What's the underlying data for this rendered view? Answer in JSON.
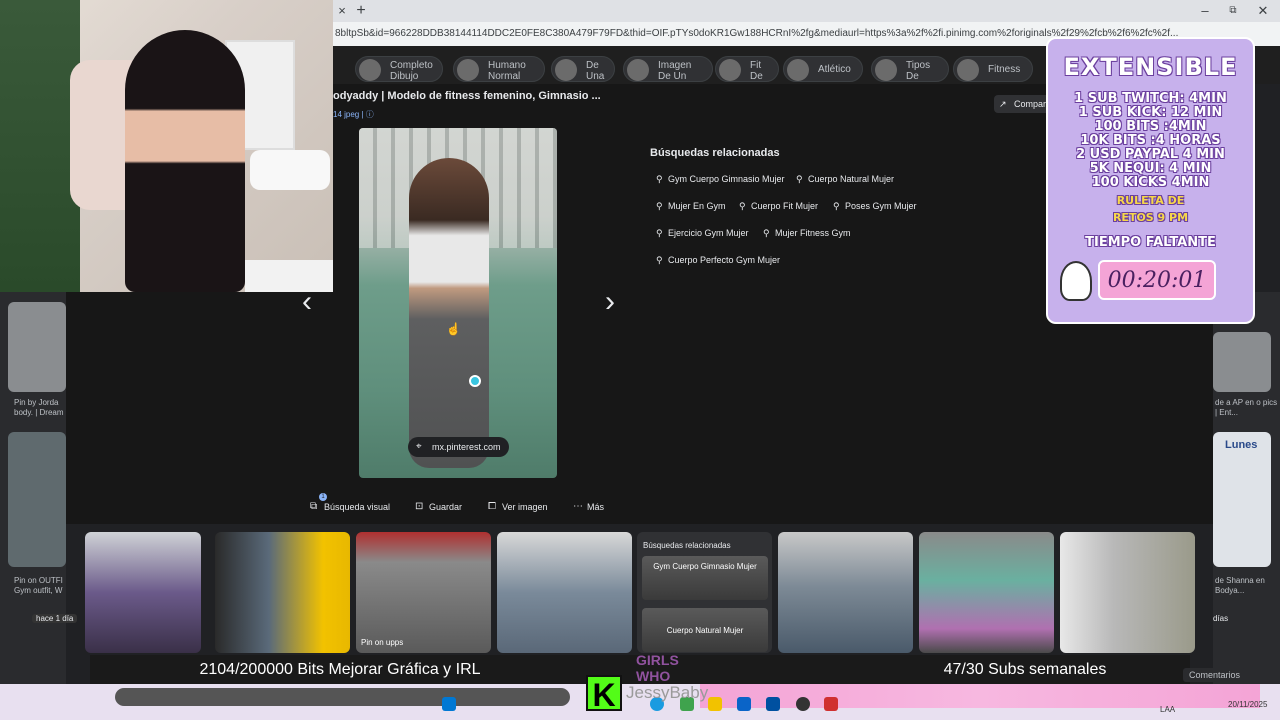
{
  "browser": {
    "new_tab": "+",
    "close_tab": "×",
    "url": "8bltpSb&id=966228DDB38144114DDC2E0FE8C380A479F79FD&thid=OIF.pTYs0doKR1Gw188HCRnI%2fg&mediaurl=https%3a%2f%2fi.pinimg.com%2foriginals%2f29%2fcb%2f6%2fc%2f...",
    "minimize": "–",
    "restore": "⧉",
    "close": "✕"
  },
  "chips": [
    {
      "label": "Completo Dibujo"
    },
    {
      "label": "Humano Normal"
    },
    {
      "label": "De Una"
    },
    {
      "label": "Imagen De Un"
    },
    {
      "label": "Fit De"
    },
    {
      "label": "Atlético"
    },
    {
      "label": "Tipos De"
    },
    {
      "label": "Fitness"
    }
  ],
  "viewer": {
    "title": "odyaddy | Modelo de fitness femenino, Gimnasio ...",
    "meta": "14 jpeg  |  ⓘ",
    "source": "mx.pinterest.com",
    "share": "Compart"
  },
  "related": {
    "heading": "Búsquedas relacionadas",
    "items": [
      "Gym Cuerpo Gimnasio Mujer",
      "Cuerpo Natural Mujer",
      "Mujer En Gym",
      "Cuerpo Fit Mujer",
      "Poses Gym Mujer",
      "Ejercicio Gym Mujer",
      "Mujer Fitness Gym",
      "Cuerpo Perfecto Gym Mujer"
    ]
  },
  "actions": {
    "visual_search": "Búsqueda visual",
    "badge": "1",
    "save": "Guardar",
    "view_image": "Ver imagen",
    "more": "Más"
  },
  "grid": {
    "card_title": "Búsquedas relacionadas",
    "card_item_1": "Gym Cuerpo Gimnasio Mujer",
    "card_item_2": "Cuerpo Natural Mujer",
    "pin_label": "Pin on upps"
  },
  "left_strip": {
    "caption_1": "Pin by Jorda body. | Dream",
    "caption_2": "Pin on OUTFI Gym outfit, W",
    "hace": "hace 1 día"
  },
  "right_strip": {
    "caption_1": "de a AP en o pics | Ent...",
    "caption_2": "de Shanna en Bodya...",
    "dias": "días",
    "lunes": "Lunes"
  },
  "widget": {
    "title": "EXTENSIBLE",
    "lines": [
      "1 SUB TWITCH: 4MIN",
      "1 SUB KICK: 12 MIN",
      "100 BITS :4MIN",
      "10K BITS :4 HORAS",
      "2 USD PAYPAL 4 MIN",
      "5K NEQUI: 4 MIN",
      "100 KICKS 4MIN"
    ],
    "ruleta_1": "RULETA DE",
    "ruleta_2": "RETOS 9 PM",
    "tiempo": "TIEMPO FALTANTE",
    "timer": "00:20:01"
  },
  "overlay": {
    "goal_bits": "2104/200000 Bits Mejorar Gráfica y IRL",
    "goal_subs": "47/30 Subs semanales",
    "girls_who": "GIRLS WHO",
    "kick_logo": "K",
    "channel": "JessyBaby",
    "comments": "Comentarios"
  },
  "taskbar": {
    "lang": "LAA",
    "date": "20/11/2025"
  },
  "colors": {
    "accent": "#8ab4f8",
    "widget_bg": "#c7b1ec",
    "timer_bg": "#f4a4d6",
    "kick_green": "#53fc18",
    "dot": "#39c5e0"
  }
}
